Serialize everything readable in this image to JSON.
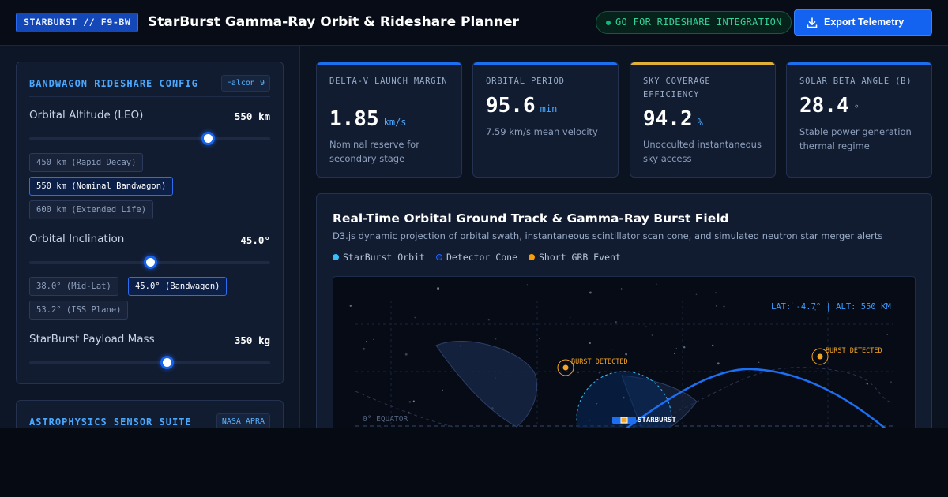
{
  "header": {
    "mission_badge": "STARBURST // F9-BW",
    "title": "StarBurst Gamma-Ray Orbit & Rideshare Planner",
    "status": "GO FOR RIDESHARE INTEGRATION",
    "export_label": "Export Telemetry"
  },
  "config": {
    "title": "BANDWAGON RIDESHARE CONFIG",
    "tag": "Falcon 9",
    "altitude": {
      "label": "Orbital Altitude (LEO)",
      "value": "550 km",
      "slider_fraction": 0.74,
      "presets": [
        "450 km (Rapid Decay)",
        "550 km (Nominal Bandwagon)",
        "600 km (Extended Life)"
      ],
      "active_preset": 1
    },
    "inclination": {
      "label": "Orbital Inclination",
      "value": "45.0°",
      "slider_fraction": 0.5,
      "presets": [
        "38.0° (Mid-Lat)",
        "45.0° (Bandwagon)",
        "53.2° (ISS Plane)"
      ],
      "active_preset": 1
    },
    "payload": {
      "label": "StarBurst Payload Mass",
      "value": "350 kg",
      "slider_fraction": 0.57
    }
  },
  "sensor_suite": {
    "title": "ASTROPHYSICS SENSOR SUITE",
    "tag": "NASA APRA"
  },
  "metrics": [
    {
      "label": "DELTA-V LAUNCH MARGIN",
      "value": "1.85",
      "unit": "km/s",
      "note": "Nominal reserve for secondary stage"
    },
    {
      "label": "ORBITAL PERIOD",
      "value": "95.6",
      "unit": "min",
      "note": "7.59 km/s mean velocity"
    },
    {
      "label": "SKY COVERAGE EFFICIENCY",
      "value": "94.2",
      "unit": "%",
      "note": "Unocculted instantaneous sky access"
    },
    {
      "label": "SOLAR BETA ANGLE (B)",
      "value": "28.4",
      "unit": "°",
      "note": "Stable power generation thermal regime"
    }
  ],
  "ground_track": {
    "title": "Real-Time Orbital Ground Track & Gamma-Ray Burst Field",
    "subtitle": "D3.js dynamic projection of orbital swath, instantaneous scintillator scan cone, and simulated neutron star merger alerts",
    "legend": [
      {
        "label": "StarBurst Orbit",
        "color": "#38bdf8"
      },
      {
        "label": "Detector Cone",
        "color": "#1d4ed8"
      },
      {
        "label": "Short GRB Event",
        "color": "#f59e0b"
      }
    ],
    "coord_readout": "LAT: -4.7° | ALT: 550 KM",
    "equator_label": "0° EQUATOR",
    "burst_labels": [
      "BURST DETECTED",
      "BURST DETECTED"
    ],
    "satellite_label": "STARBURST"
  },
  "colors": {
    "accent": "#1463f0",
    "status_green": "#34d399",
    "burst": "#f5a524",
    "label_blue": "#4aa8ff"
  },
  "icons": {
    "export": "download-icon",
    "status": "status-dot-icon"
  }
}
